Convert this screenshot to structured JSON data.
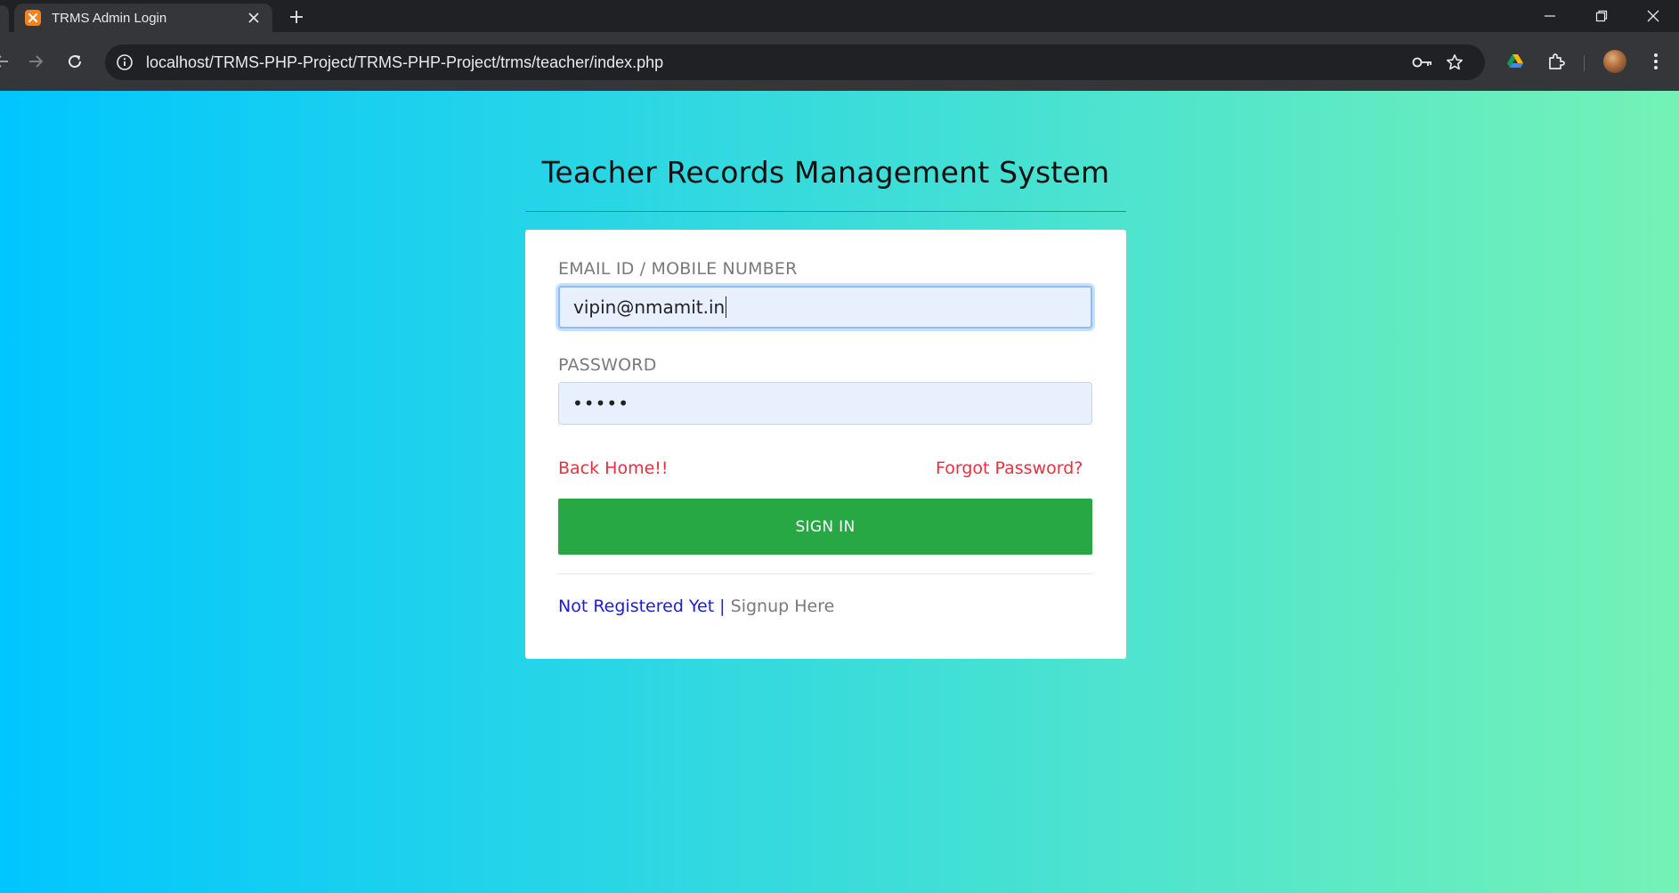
{
  "browser": {
    "tab_title": "TRMS Admin Login",
    "url": "localhost/TRMS-PHP-Project/TRMS-PHP-Project/trms/teacher/index.php"
  },
  "page": {
    "title": "Teacher Records Management System"
  },
  "login_form": {
    "email_label": "EMAIL ID / MOBILE NUMBER",
    "email_value": "vipin@nmamit.in",
    "password_label": "PASSWORD",
    "password_masked": "•••••",
    "back_home_link": "Back Home!!",
    "forgot_password_link": "Forgot Password?",
    "sign_in_button": "SIGN IN",
    "not_registered_text": "Not Registered Yet |",
    "signup_link": "Signup Here"
  },
  "colors": {
    "gradient_start": "#00c6ff",
    "gradient_end": "#74f2b6",
    "sign_in_green": "#28a745",
    "link_red": "#e8303f",
    "link_blue": "#1a1ae0"
  }
}
